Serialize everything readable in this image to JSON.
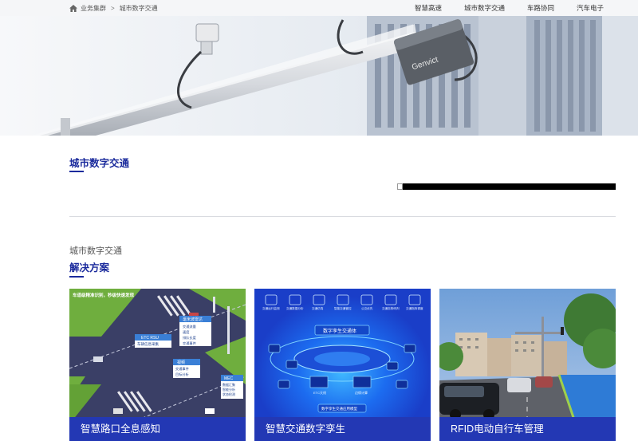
{
  "breadcrumb": {
    "home_icon": "home-icon",
    "level1": "业务集群",
    "separator": ">",
    "level2": "城市数字交通"
  },
  "nav": {
    "items": [
      {
        "label": "智慧高速"
      },
      {
        "label": "城市数字交通"
      },
      {
        "label": "车路协同"
      },
      {
        "label": "汽车电子"
      }
    ]
  },
  "hero": {
    "camera_brand": "Genvict"
  },
  "section": {
    "title": "城市数字交通"
  },
  "solutions": {
    "subtitle": "城市数字交通",
    "title": "解决方案",
    "cards": [
      {
        "label": "智慧路口全息感知",
        "image_texts": {
          "banner": "车道级精准识别，秒级快速发现",
          "box1_title": "ETC RSU",
          "box1_item": "车辆信息采集",
          "box2_title": "毫米波雷达",
          "box2_items": [
            "交通流量",
            "速度",
            "排队长度",
            "交通事件"
          ],
          "box3_title": "视频",
          "box3_items": [
            "交通事件",
            "目标分析"
          ],
          "box4_title": "MEC",
          "box4_items": [
            "数据汇聚",
            "智能分析",
            "状态检测"
          ]
        }
      },
      {
        "label": "智慧交通数字孪生",
        "image_texts": {
          "center": "数字孪生交通体",
          "bottom": "数字孪生交通应用模型",
          "top_items": [
            "交通运行监测",
            "交通数据分析",
            "交通仿真",
            "智能交通管控",
            "公交优先",
            "交通态势研判",
            "交通指挥调度"
          ],
          "mid_items": [
            "ETC天线",
            "边缘计算"
          ]
        }
      },
      {
        "label": "RFID电动自行车管理"
      }
    ]
  },
  "colors": {
    "brand_blue": "#1a2a9c",
    "card_label_bg": "#2338b4"
  }
}
